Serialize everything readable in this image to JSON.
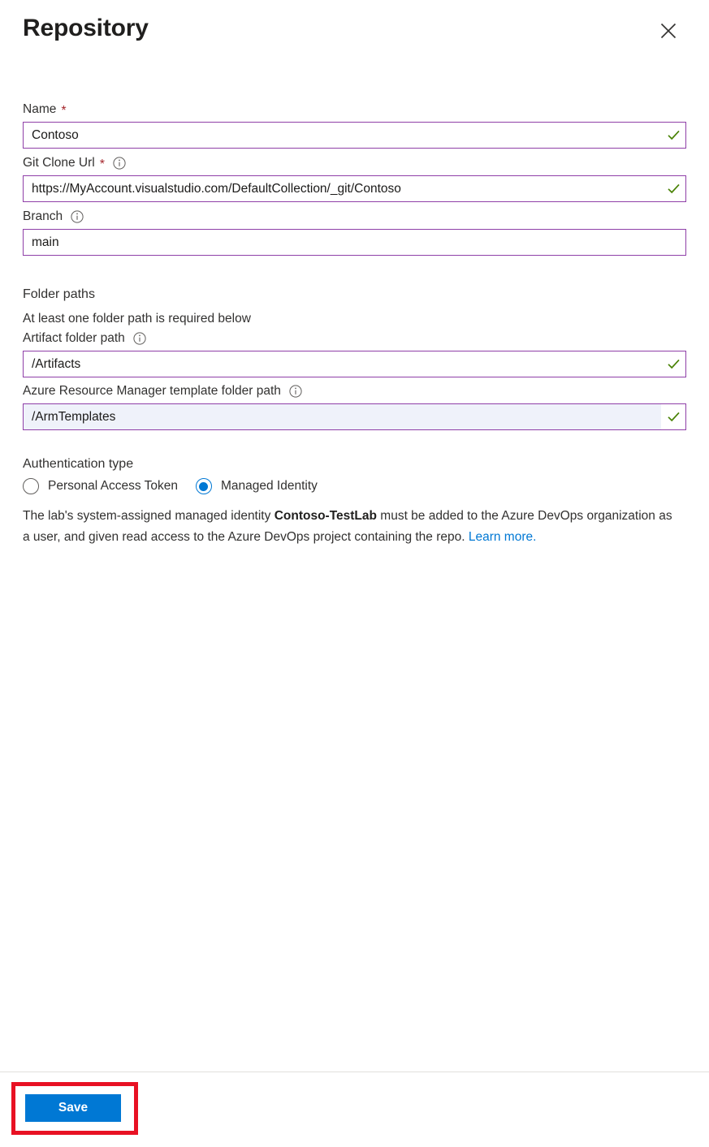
{
  "blade": {
    "title": "Repository",
    "close_label": "Close",
    "close_icon": "close-icon"
  },
  "fields": {
    "name": {
      "label": "Name",
      "required_marker": "*",
      "value": "Contoso",
      "validated": true,
      "validation_icon": "checkmark-icon"
    },
    "git_clone_url": {
      "label": "Git Clone Url",
      "required_marker": "*",
      "info_icon": "info-icon",
      "value": "https://MyAccount.visualstudio.com/DefaultCollection/_git/Contoso",
      "validated": true,
      "validation_icon": "checkmark-icon"
    },
    "branch": {
      "label": "Branch",
      "info_icon": "info-icon",
      "value": "main",
      "validated": false
    }
  },
  "folder_paths": {
    "heading": "Folder paths",
    "note": "At least one folder path is required below",
    "artifact": {
      "label": "Artifact folder path",
      "info_icon": "info-icon",
      "value": "/Artifacts",
      "validated": true,
      "validation_icon": "checkmark-icon"
    },
    "arm_template": {
      "label": "Azure Resource Manager template folder path",
      "info_icon": "info-icon",
      "value": "/ArmTemplates",
      "validated": true,
      "validation_icon": "checkmark-icon",
      "highlighted": true
    }
  },
  "authentication": {
    "heading": "Authentication type",
    "options": [
      {
        "label": "Personal Access Token",
        "selected": false
      },
      {
        "label": "Managed Identity",
        "selected": true
      }
    ],
    "description": {
      "part1": "The lab's system-assigned managed identity ",
      "identity": "Contoso-TestLab",
      "part2": " must be added to the Azure DevOps organization as a user, and given read access to the Azure DevOps project containing the repo. ",
      "link": "Learn more."
    }
  },
  "footer": {
    "save_label": "Save"
  },
  "colors": {
    "accent_blue": "#0078d4",
    "link_blue": "#0078d4",
    "input_border_purple": "#8f3fa8",
    "validation_green": "#498205",
    "required_red": "#a4262c",
    "highlight_red": "#e81123",
    "field_highlight_bg": "#eff2fa"
  }
}
